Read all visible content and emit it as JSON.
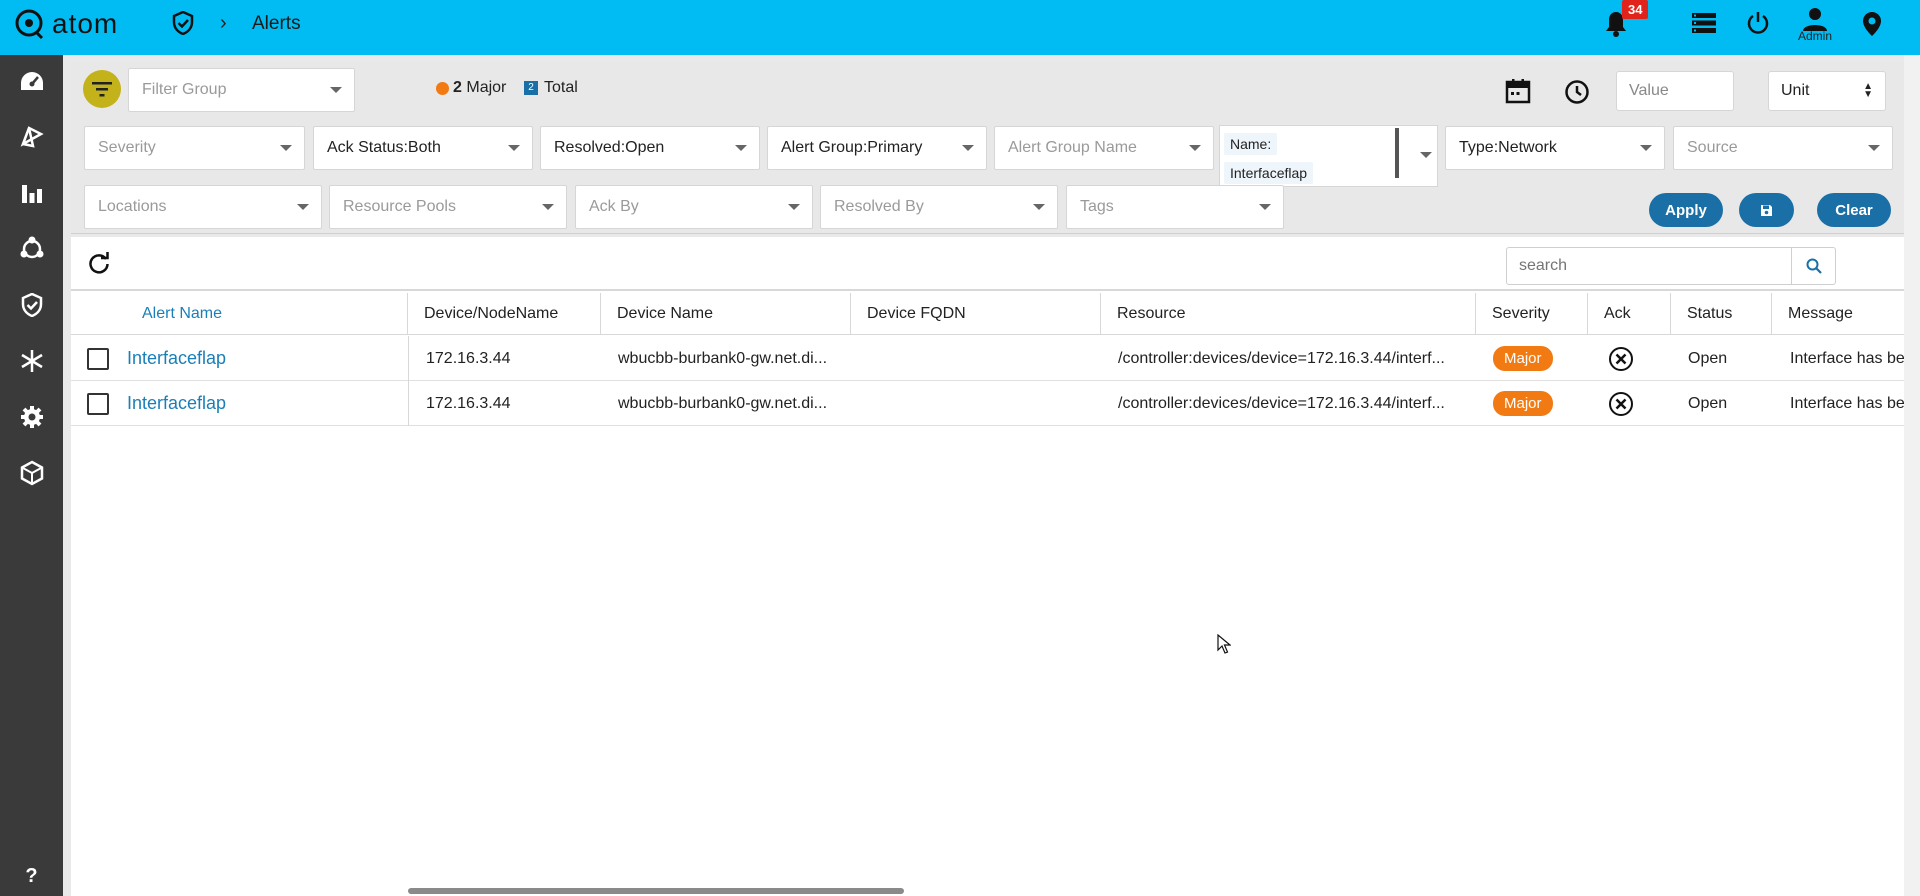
{
  "topbar": {
    "app_name": "atom",
    "breadcrumb_title": "Alerts",
    "notification_count": "34",
    "admin_label": "Admin"
  },
  "filters": {
    "filter_group_placeholder": "Filter Group",
    "major_count": "2",
    "major_label": "Major",
    "total_count": "2",
    "total_label": "Total",
    "value_placeholder": "Value",
    "unit_value": "Unit",
    "severity": "Severity",
    "ack_status": "Ack Status:Both",
    "resolved": "Resolved:Open",
    "alert_group": "Alert Group:Primary",
    "alert_group_name": "Alert Group Name",
    "name_label": "Name:",
    "name_value": "Interfaceflap",
    "type": "Type:Network",
    "source": "Source",
    "locations": "Locations",
    "resource_pools": "Resource Pools",
    "ack_by": "Ack By",
    "resolved_by": "Resolved By",
    "tags": "Tags",
    "apply_label": "Apply",
    "clear_label": "Clear"
  },
  "table": {
    "search_placeholder": "search",
    "columns": [
      "Alert Name",
      "Device/NodeName",
      "Device Name",
      "Device FQDN",
      "Resource",
      "Severity",
      "Ack",
      "Status",
      "Message"
    ],
    "rows": [
      {
        "alert_name": "Interfaceflap",
        "node": "172.16.3.44",
        "device_name": "wbucbb-burbank0-gw.net.di...",
        "fqdn": "",
        "resource": "/controller:devices/device=172.16.3.44/interf...",
        "severity": "Major",
        "status": "Open",
        "message": "Interface has be"
      },
      {
        "alert_name": "Interfaceflap",
        "node": "172.16.3.44",
        "device_name": "wbucbb-burbank0-gw.net.di...",
        "fqdn": "",
        "resource": "/controller:devices/device=172.16.3.44/interf...",
        "severity": "Major",
        "status": "Open",
        "message": "Interface has be"
      }
    ]
  },
  "colors": {
    "topbar": "#00bcf2",
    "sidebar": "#3a3a3a",
    "accent": "#1a6fa6",
    "major": "#f27a12",
    "filter_button": "#c3b21a"
  }
}
